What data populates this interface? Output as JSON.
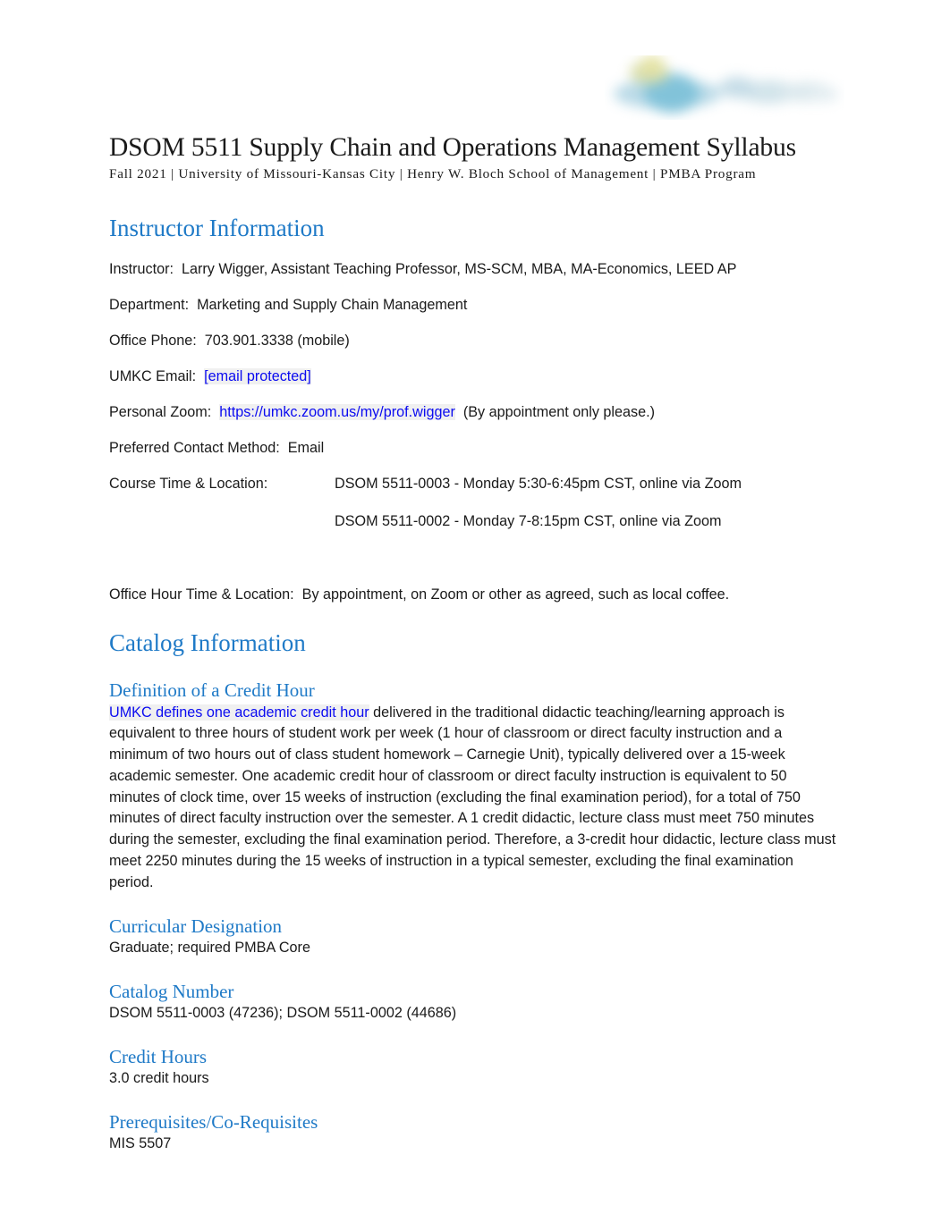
{
  "document": {
    "title": "DSOM 5511 Supply Chain and Operations Management Syllabus",
    "subtitle": "Fall 2021 | University of Missouri-Kansas City | Henry W. Bloch School of Management | PMBA Program"
  },
  "header": {
    "logo_alt": "UMKC Henry W. Bloch School of Management logo"
  },
  "colors": {
    "heading_blue": "#1F7AC7",
    "link_blue": "#0B0BF0",
    "body_text": "#1A1A1A",
    "page_background": "#FFFFFF"
  },
  "instructor_information": {
    "heading": "Instructor Information",
    "rows": [
      {
        "label": "Instructor:",
        "value": "Larry Wigger, Assistant Teaching Professor, MS-SCM, MBA, MA-Economics, LEED AP"
      },
      {
        "label": "Department:",
        "value": "Marketing and Supply Chain Management"
      },
      {
        "label": "Office Phone:",
        "value": "703.901.3338 (mobile)"
      }
    ],
    "email_row": {
      "label": "UMKC Email:",
      "link_text": "[email protected]"
    },
    "zoom_row": {
      "label": "Personal Zoom:",
      "link_text": "https://umkc.zoom.us/my/prof.wigger",
      "suffix": "(By appointment only please.)"
    },
    "contact_row": {
      "label": "Preferred Contact Method:",
      "value": "Email"
    },
    "course_time": {
      "label": "Course Time & Location:",
      "sections": [
        "DSOM 5511-0003 - Monday 5:30-6:45pm CST, online via Zoom",
        "DSOM 5511-0002 - Monday 7-8:15pm CST, online via Zoom"
      ]
    },
    "office_hour": {
      "label": "Office Hour Time & Location:",
      "value": "By appointment, on Zoom or other as agreed, such as local coffee."
    }
  },
  "catalog_information": {
    "heading": "Catalog Information",
    "credit_hour": {
      "heading": "Definition of a Credit Hour",
      "link_text": "UMKC defines one academic credit hour",
      "body": " delivered in the traditional didactic teaching/learning approach is equivalent to three hours of student work per week (1 hour of classroom or direct faculty instruction and a minimum of two hours out of class student homework – Carnegie Unit), typically delivered over a 15-week academic semester. One academic credit hour of classroom or direct faculty instruction is equivalent to 50 minutes of clock time, over 15 weeks of instruction (excluding the final examination period), for a total of 750 minutes of direct faculty instruction over the semester. A 1 credit didactic, lecture class must meet 750 minutes during the semester, excluding the final examination period. Therefore, a 3-credit hour didactic, lecture class must meet 2250 minutes during the 15 weeks of instruction in a typical semester, excluding the final examination period."
    },
    "curricular_designation": {
      "heading": "Curricular Designation",
      "body": "Graduate; required PMBA Core"
    },
    "catalog_number": {
      "heading": "Catalog Number",
      "body": "DSOM 5511-0003 (47236); DSOM 5511-0002 (44686)"
    },
    "credit_hours": {
      "heading": "Credit Hours",
      "body": "3.0 credit hours"
    },
    "prerequisites": {
      "heading": "Prerequisites/Co-Requisites",
      "body": "MIS 5507"
    }
  }
}
